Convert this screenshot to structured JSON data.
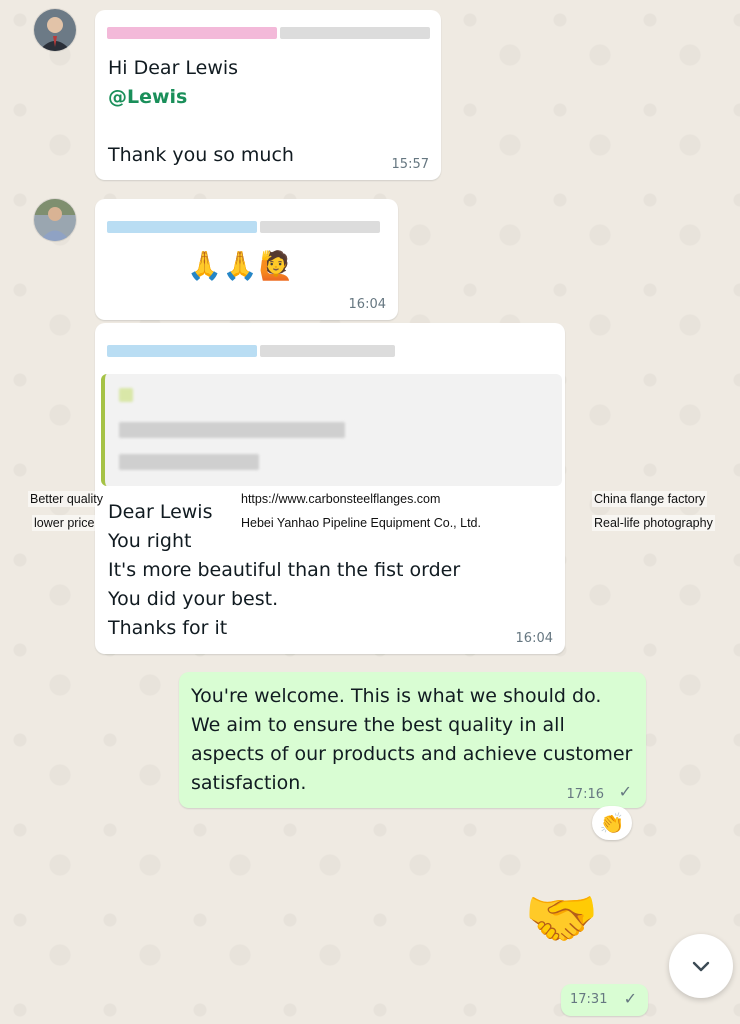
{
  "messages": [
    {
      "lines": [
        "Hi Dear Lewis"
      ],
      "mention": "@Lewis",
      "closing": "Thank you so much",
      "time": "15:57"
    },
    {
      "emojis": "🙏🙏🙋",
      "time": "16:04"
    },
    {
      "text": "Dear Lewis\nYou right\nIt's more beautiful than the fist order\nYou did your best.\nThanks for it",
      "time": "16:04"
    },
    {
      "text": "You're welcome. This is what we should do.\nWe aim to ensure the best quality in all\naspects of our products and achieve customer\nsatisfaction.",
      "time": "17:16",
      "reaction": "👏"
    },
    {
      "sticker": "🤝",
      "time": "17:31"
    }
  ],
  "watermark": {
    "left_top": "Better quality",
    "left_bottom": "lower price",
    "center_top": "https://www.carbonsteelflanges.com",
    "center_bottom": "Hebei Yanhao Pipeline Equipment Co., Ltd.",
    "right_top": "China flange factory",
    "right_bottom": "Real-life photography"
  },
  "icons": {
    "read_receipt": "double-check-icon",
    "scroll_down": "chevron-down-icon"
  },
  "colors": {
    "chat_background": "#efeae2",
    "incoming_bubble": "#ffffff",
    "outgoing_bubble": "#d9fdd3",
    "mention": "#1a8f5a",
    "quote_bar": "#a5c245"
  }
}
